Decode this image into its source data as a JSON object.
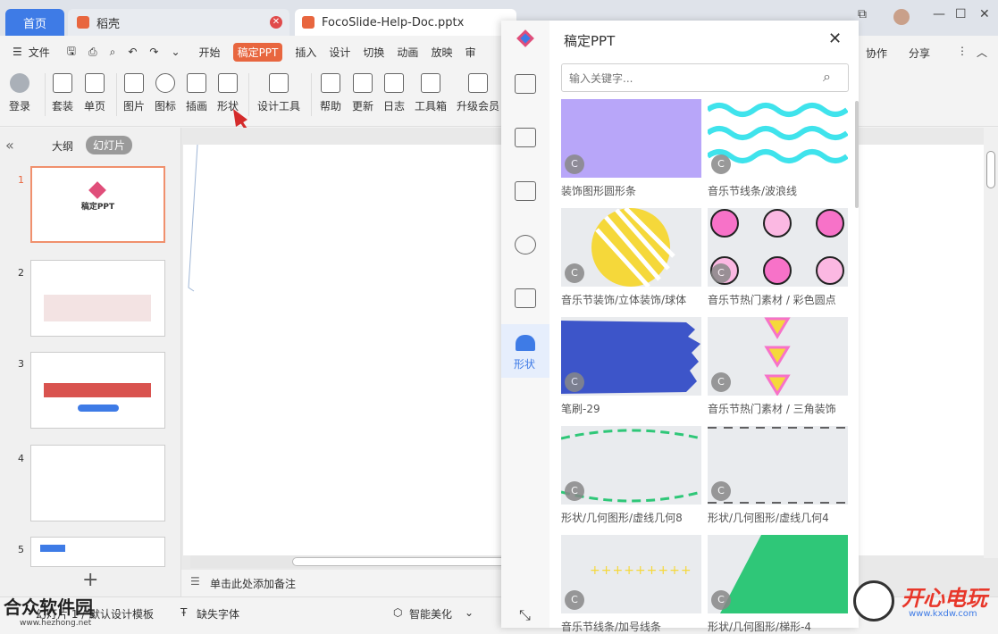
{
  "tabs": {
    "home": "首页",
    "shell": "稻壳",
    "doc": "FocoSlide-Help-Doc.pptx"
  },
  "menu": {
    "file": "文件",
    "items": [
      "开始",
      "稿定PPT",
      "插入",
      "设计",
      "切换",
      "动画",
      "放映",
      "审"
    ],
    "right": [
      "协作",
      "分享"
    ]
  },
  "toolbar": [
    "登录",
    "套装",
    "单页",
    "图片",
    "图标",
    "插画",
    "形状",
    "设计工具",
    "帮助",
    "更新",
    "日志",
    "工具箱",
    "升级会员"
  ],
  "left": {
    "tab_outline": "大纲",
    "tab_slides": "幻灯片",
    "slide_numbers": [
      "1",
      "2",
      "3",
      "4",
      "5"
    ],
    "slide1_title": "稿定PPT"
  },
  "canvas": {
    "notes": "单击此处添加备注"
  },
  "status": {
    "slide_info": "幻灯片 1 / 5",
    "template": "默认设计模板",
    "font": "缺失字体",
    "beautify": "智能美化"
  },
  "panel": {
    "title": "稿定PPT",
    "search_placeholder": "输入关键字...",
    "nav_active": "形状",
    "badge": "C",
    "items": [
      "装饰图形圆形条",
      "音乐节线条/波浪线",
      "音乐节装饰/立体装饰/球体",
      "音乐节热门素材 / 彩色圆点",
      "笔刷-29",
      "音乐节热门素材 / 三角装饰",
      "形状/几何图形/虚线几何8",
      "形状/几何图形/虚线几何4",
      "音乐节线条/加号线条",
      "形状/几何图形/梯形-4"
    ],
    "colors": {
      "purple": "#b8a6f9",
      "cyan": "#3fe3ec",
      "yellow": "#f5d83a",
      "pink": "#f772c8",
      "blue": "#3d55c9",
      "green": "#2fc778"
    }
  },
  "watermark": {
    "left": "合众软件园",
    "left_url": "www.hezhong.net",
    "right": "开心电玩",
    "right_url": "www.kxdw.com"
  }
}
